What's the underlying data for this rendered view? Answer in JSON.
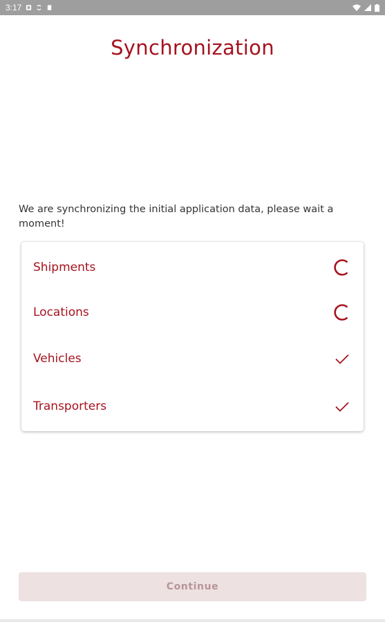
{
  "status_bar": {
    "time": "3:17"
  },
  "page": {
    "title": "Synchronization",
    "intro": "We are synchronizing the initial application data, please wait a moment!"
  },
  "sync_items": [
    {
      "label": "Shipments",
      "state": "loading-icon"
    },
    {
      "label": "Locations",
      "state": "loading-icon"
    },
    {
      "label": "Vehicles",
      "state": "check-icon"
    },
    {
      "label": "Transporters",
      "state": "check-icon"
    }
  ],
  "actions": {
    "continue_label": "Continue",
    "continue_enabled": false
  },
  "colors": {
    "accent": "#a5121e",
    "button_disabled_bg": "#ede1e2",
    "button_disabled_text": "#b79599",
    "status_bar": "#9e9e9e"
  }
}
